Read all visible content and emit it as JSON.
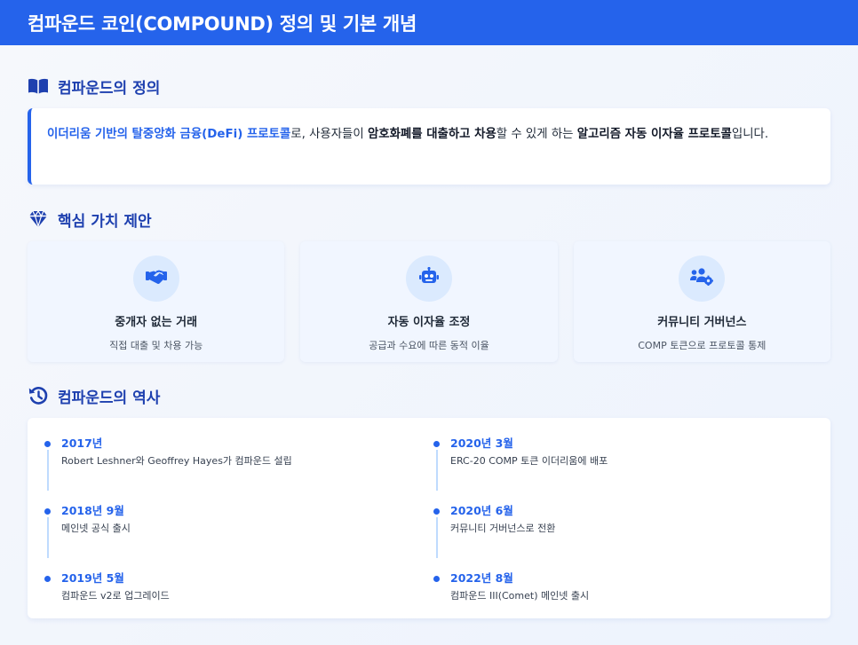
{
  "header": {
    "title": "컴파운드 코인(COMPOUND) 정의 및 기본 개념"
  },
  "definition": {
    "title": "컴파운드의 정의",
    "icon": "book-open-icon",
    "text": {
      "highlight": "이더리움 기반의 탈중앙화 금융(DeFi) 프로토콜",
      "part1": "로, 사용자들이 ",
      "bold1": "암호화폐를 대출하고 차용",
      "part2": "할 수 있게 하는 ",
      "bold2": "알고리즘 자동 이자율 프로토콜",
      "part3": "입니다."
    }
  },
  "value": {
    "title": "핵심 가치 제안",
    "icon": "gem-icon",
    "cards": [
      {
        "icon": "handshake-icon",
        "title": "중개자 없는 거래",
        "desc": "직접 대출 및 차용 가능"
      },
      {
        "icon": "robot-icon",
        "title": "자동 이자율 조정",
        "desc": "공급과 수요에 따른 동적 이율"
      },
      {
        "icon": "users-cog-icon",
        "title": "커뮤니티 거버넌스",
        "desc": "COMP 토큰으로 프로토콜 통제"
      }
    ]
  },
  "history": {
    "title": "컴파운드의 역사",
    "icon": "history-icon",
    "left": [
      {
        "date": "2017년",
        "text": "Robert Leshner와 Geoffrey Hayes가 컴파운드 설립"
      },
      {
        "date": "2018년 9월",
        "text": "메인넷 공식 출시"
      },
      {
        "date": "2019년 5월",
        "text": "컴파운드 v2로 업그레이드"
      }
    ],
    "right": [
      {
        "date": "2020년 3월",
        "text": "ERC-20 COMP 토큰 이더리움에 배포"
      },
      {
        "date": "2020년 6월",
        "text": "커뮤니티 거버넌스로 전환"
      },
      {
        "date": "2022년 8월",
        "text": "컴파운드 III(Comet) 메인넷 출시"
      }
    ]
  },
  "colors": {
    "primary": "#2563eb",
    "dark_primary": "#1e40af",
    "card_bg": "#f1f6ff",
    "icon_circle": "#dbeafe"
  }
}
